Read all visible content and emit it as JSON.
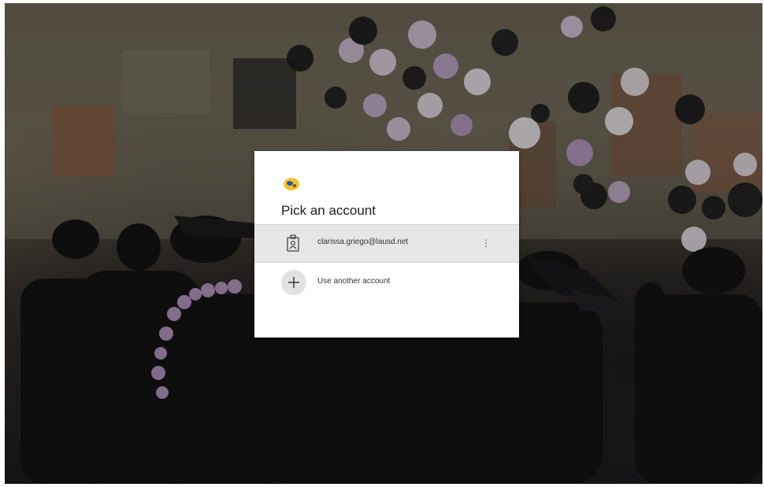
{
  "background": {
    "scene": "graduation-ceremony-photo"
  },
  "dialog": {
    "logo_icon": "lausd-seal-icon",
    "title": "Pick an account",
    "accounts": [
      {
        "icon": "badge-icon",
        "email": "clarissa.griego@lausd.net",
        "more_icon": "more-options-icon"
      }
    ],
    "another_account": {
      "icon": "plus-icon",
      "label": "Use another account"
    }
  },
  "colors": {
    "dialog_bg": "#ffffff",
    "selected_row_bg": "#e6e6e6",
    "logo_yellow": "#f2c12e"
  }
}
